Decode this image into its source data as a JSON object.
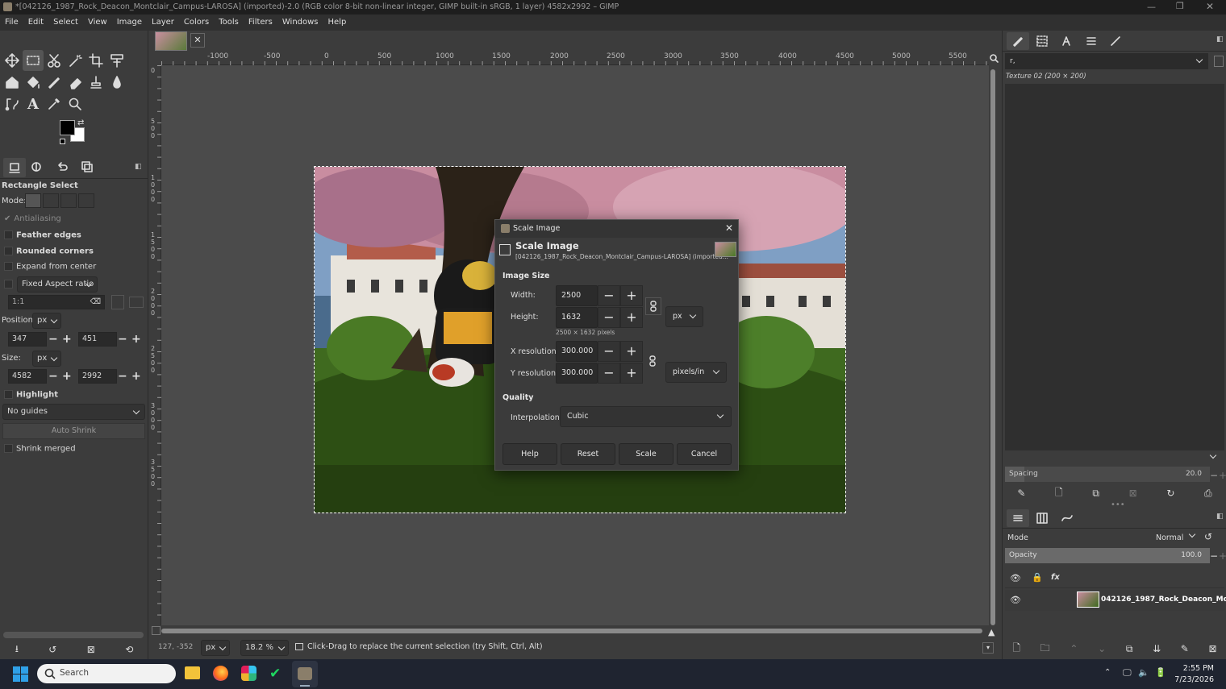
{
  "window": {
    "title": "*[042126_1987_Rock_Deacon_Montclair_Campus-LAROSA] (imported)-2.0 (RGB color 8-bit non-linear integer, GIMP built-in sRGB, 1 layer) 4582x2992 – GIMP"
  },
  "menu": [
    "File",
    "Edit",
    "Select",
    "View",
    "Image",
    "Layer",
    "Colors",
    "Tools",
    "Filters",
    "Windows",
    "Help"
  ],
  "hruler_ticks": [
    "-1000",
    "-500",
    "0",
    "500",
    "1000",
    "1500",
    "2000",
    "2500",
    "3000",
    "3500",
    "4000",
    "4500",
    "5000",
    "5500"
  ],
  "vruler_ticks": [
    "0",
    "500",
    "1000",
    "1500",
    "2000",
    "2500",
    "3000",
    "3500"
  ],
  "tool_options": {
    "title": "Rectangle Select",
    "mode_label": "Mode:",
    "antialiasing": "Antialiasing",
    "feather": "Feather edges",
    "rounded": "Rounded corners",
    "expand": "Expand from center",
    "fixed": "Fixed Aspect ratio",
    "ratio": "1:1",
    "position_label": "Position:",
    "position_unit": "px",
    "pos_x": "347",
    "pos_y": "451",
    "size_label": "Size:",
    "size_unit": "px",
    "size_w": "4582",
    "size_h": "2992",
    "highlight": "Highlight",
    "guides": "No guides",
    "auto_shrink": "Auto Shrink",
    "shrink_merged": "Shrink merged"
  },
  "dialog": {
    "window_title": "Scale Image",
    "heading": "Scale Image",
    "subtitle": "[042126_1987_Rock_Deacon_Montclair_Campus-LAROSA] (imported...",
    "image_size": "Image Size",
    "width_label": "Width:",
    "width": "2500",
    "height_label": "Height:",
    "height": "1632",
    "size_unit": "px",
    "pixels_note": "2500 × 1632 pixels",
    "xres_label": "X resolution:",
    "xres": "300.000",
    "yres_label": "Y resolution:",
    "yres": "300.000",
    "res_unit": "pixels/in",
    "quality": "Quality",
    "interp_label": "Interpolation:",
    "interp": "Cubic",
    "help": "Help",
    "reset": "Reset",
    "scale": "Scale",
    "cancel": "Cancel"
  },
  "brushes": {
    "filter": "r,",
    "brush_name": "Texture 02 (200 × 200)",
    "spacing_label": "Spacing",
    "spacing": "20.0"
  },
  "layers": {
    "mode_label": "Mode",
    "mode": "Normal",
    "opacity_label": "Opacity",
    "opacity": "100.0",
    "layer_name": "042126_1987_Rock_Deacon_Montc"
  },
  "status": {
    "coords": "127, -352",
    "unit": "px",
    "zoom": "18.2 %",
    "message": "Click-Drag to replace the current selection (try Shift, Ctrl, Alt)"
  },
  "taskbar": {
    "search": "Search",
    "time": "2:55 PM",
    "date": "7/23/2026"
  },
  "colors": {
    "accent": "#29a3e0",
    "dialog_bg": "#3b3b3b",
    "panel_bg": "#3c3c3c"
  }
}
